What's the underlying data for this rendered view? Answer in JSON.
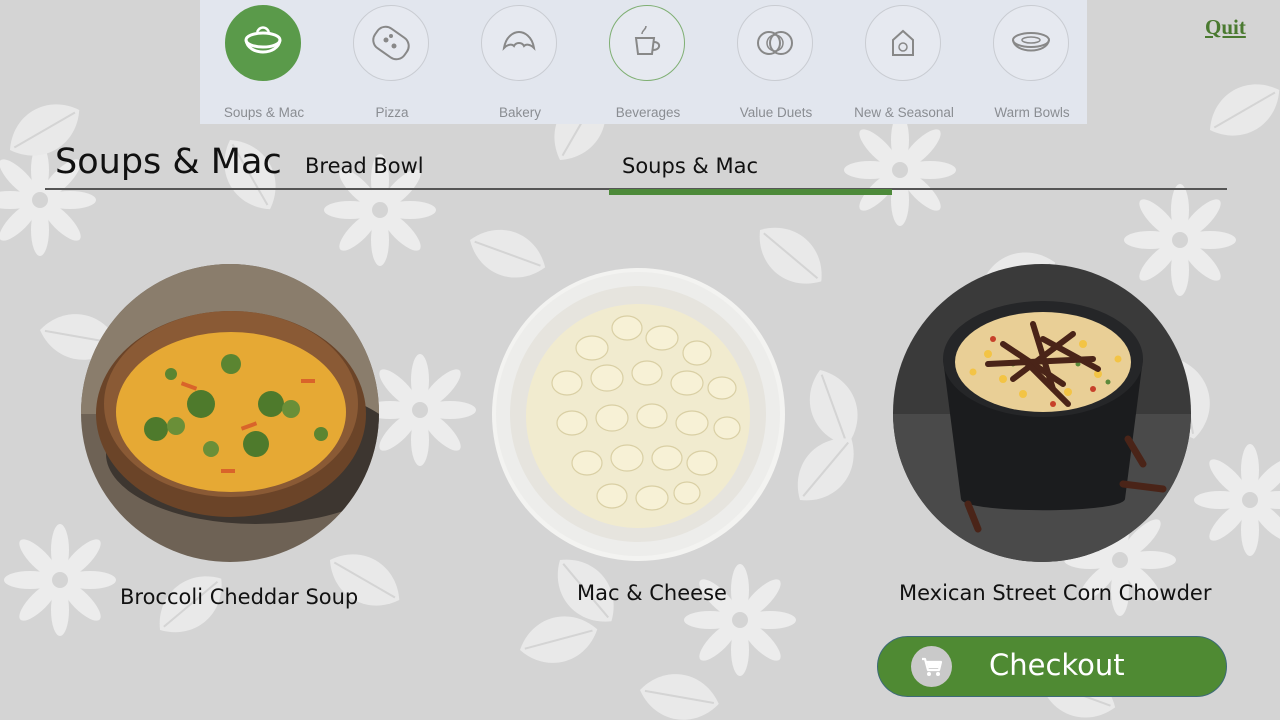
{
  "categories": [
    {
      "label": "Soups & Mac",
      "icon": "soup-bowl-icon",
      "active": true
    },
    {
      "label": "Pizza",
      "icon": "flatbread-icon"
    },
    {
      "label": "Bakery",
      "icon": "croissant-icon"
    },
    {
      "label": "Beverages",
      "icon": "coffee-cup-icon"
    },
    {
      "label": "Value Duets",
      "icon": "duet-rings-icon"
    },
    {
      "label": "New & Seasonal",
      "icon": "seasonal-house-icon"
    },
    {
      "label": "Warm Bowls",
      "icon": "warm-bowl-icon"
    }
  ],
  "quit_label": "Quit",
  "page_title": "Soups & Mac",
  "subtabs": [
    {
      "label": "Bread Bowl"
    },
    {
      "label": "Soups & Mac",
      "active": true
    }
  ],
  "products": [
    {
      "name": "Broccoli Cheddar Soup"
    },
    {
      "name": "Mac & Cheese"
    },
    {
      "name": "Mexican Street Corn Chowder"
    }
  ],
  "checkout": {
    "label": "Checkout",
    "icon": "shopping-cart-icon"
  },
  "colors": {
    "accent": "#4f8a33",
    "active_category": "#5a9a4a",
    "background": "#d4d4d4"
  }
}
